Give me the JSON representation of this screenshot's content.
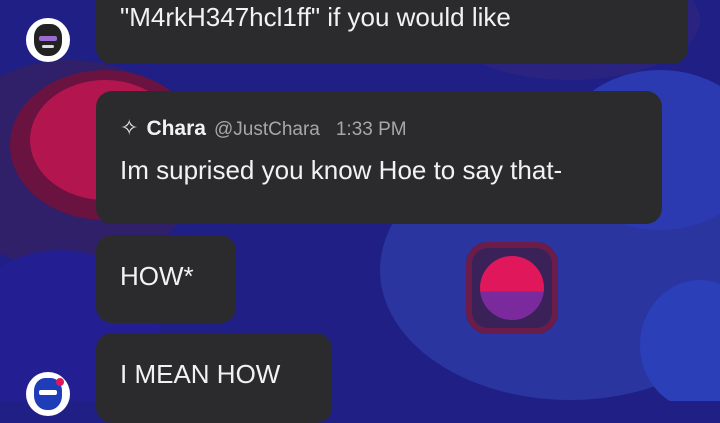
{
  "messages": [
    {
      "text": "\"M4rkH347hcl1ff\" if you would like"
    },
    {
      "author": {
        "name": "Chara",
        "handle": "@JustChara",
        "time": "1:33 PM",
        "badge_icon": "sparkle-icon"
      },
      "text": "Im suprised you know Hoe to say that-"
    },
    {
      "text": "HOW*"
    },
    {
      "text": "I MEAN HOW"
    }
  ],
  "colors": {
    "background": "#1f1f86",
    "bubble": "#2b2b2d",
    "text": "#f2f2f2",
    "muted": "#a7a7aa"
  },
  "badge_glyph": "✧"
}
